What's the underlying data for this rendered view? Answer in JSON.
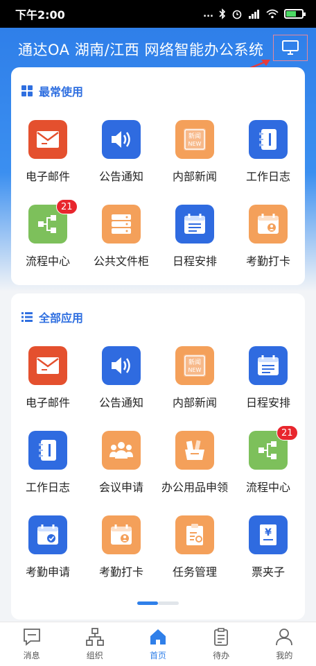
{
  "status_bar": {
    "time": "下午2:00",
    "dots": "...",
    "battery_color": "#4cd964"
  },
  "app_title": "通达OA 湖南/江西 网络智能办公系统",
  "colors": {
    "brand_blue": "#2f7fe9",
    "badge_red": "#e8262d"
  },
  "sections": [
    {
      "title": "最常使用",
      "icon": "grid-icon",
      "apps": [
        {
          "label": "电子邮件",
          "icon": "mail-icon",
          "color": "#e4502e"
        },
        {
          "label": "公告通知",
          "icon": "speaker-icon",
          "color": "#2f6be0"
        },
        {
          "label": "内部新闻",
          "icon": "news-icon",
          "color": "#f4a05a"
        },
        {
          "label": "工作日志",
          "icon": "notebook-icon",
          "color": "#2f6be0"
        },
        {
          "label": "流程中心",
          "icon": "flow-icon",
          "color": "#7dc05b",
          "badge": "21"
        },
        {
          "label": "公共文件柜",
          "icon": "cabinet-icon",
          "color": "#f4a05a"
        },
        {
          "label": "日程安排",
          "icon": "calendar-list-icon",
          "color": "#2f6be0"
        },
        {
          "label": "考勤打卡",
          "icon": "attendance-card-icon",
          "color": "#f4a05a"
        }
      ]
    },
    {
      "title": "全部应用",
      "icon": "list-icon",
      "apps": [
        {
          "label": "电子邮件",
          "icon": "mail-icon",
          "color": "#e4502e"
        },
        {
          "label": "公告通知",
          "icon": "speaker-icon",
          "color": "#2f6be0"
        },
        {
          "label": "内部新闻",
          "icon": "news-icon",
          "color": "#f4a05a"
        },
        {
          "label": "日程安排",
          "icon": "calendar-list-icon",
          "color": "#2f6be0"
        },
        {
          "label": "工作日志",
          "icon": "notebook-icon",
          "color": "#2f6be0"
        },
        {
          "label": "会议申请",
          "icon": "meeting-icon",
          "color": "#f4a05a"
        },
        {
          "label": "办公用品申领",
          "icon": "supplies-icon",
          "color": "#f4a05a"
        },
        {
          "label": "流程中心",
          "icon": "flow-icon",
          "color": "#7dc05b",
          "badge": "21"
        },
        {
          "label": "考勤申请",
          "icon": "attendance-check-icon",
          "color": "#2f6be0"
        },
        {
          "label": "考勤打卡",
          "icon": "attendance-card-icon",
          "color": "#f4a05a"
        },
        {
          "label": "任务管理",
          "icon": "task-icon",
          "color": "#f4a05a"
        },
        {
          "label": "票夹子",
          "icon": "ticket-icon",
          "color": "#2f6be0"
        }
      ]
    }
  ],
  "pager": {
    "current_page": 1,
    "page_count": 2
  },
  "news_text_top": "新闻",
  "news_text_bottom": "NEW",
  "ticket_glyph": "¥",
  "tabs": [
    {
      "label": "消息",
      "icon": "message-icon"
    },
    {
      "label": "组织",
      "icon": "org-icon"
    },
    {
      "label": "首页",
      "icon": "home-icon",
      "active": true
    },
    {
      "label": "待办",
      "icon": "todo-icon"
    },
    {
      "label": "我的",
      "icon": "profile-icon"
    }
  ]
}
